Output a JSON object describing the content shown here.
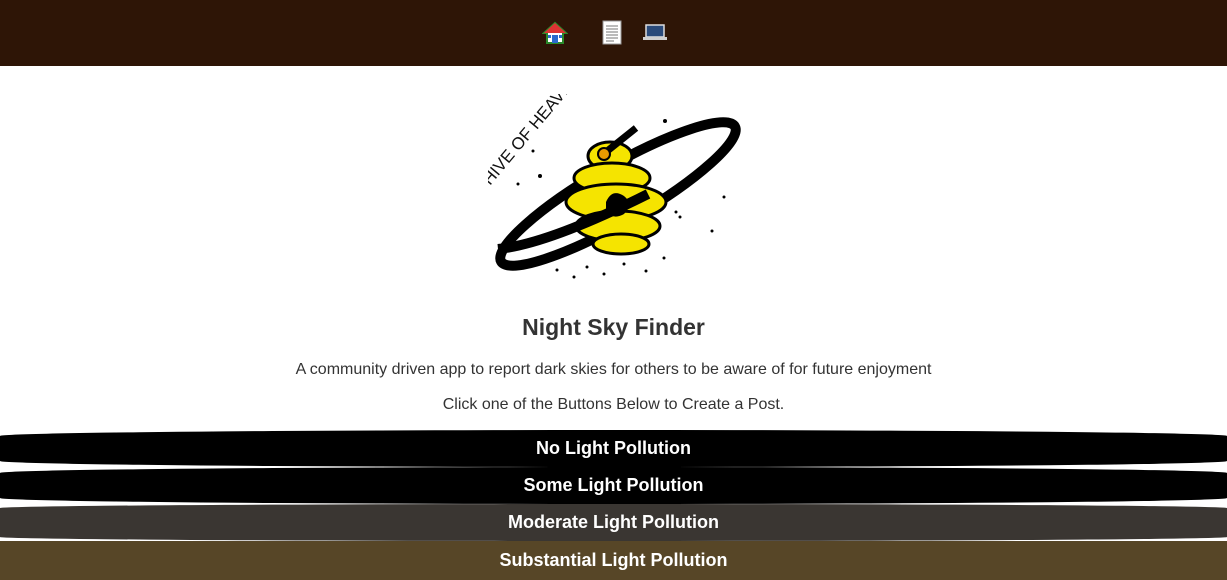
{
  "nav": {
    "items": [
      {
        "icon": "house-icon",
        "label": "Home"
      },
      {
        "icon": "document-icon",
        "label": "Posts"
      },
      {
        "icon": "laptop-icon",
        "label": "Computer"
      }
    ],
    "background": "#2e1506"
  },
  "logo": {
    "text": "HIVE OF HEAVEN"
  },
  "main": {
    "title": "Night Sky Finder",
    "tagline": "A community driven app to report dark skies for others to be aware of for future enjoyment",
    "instruction": "Click one of the Buttons Below to Create a Post."
  },
  "buttons": [
    {
      "label": "No Light Pollution",
      "color": "#000000"
    },
    {
      "label": "Some Light Pollution",
      "color": "#000000"
    },
    {
      "label": "Moderate Light Pollution",
      "color": "#3a3632"
    },
    {
      "label": "Substantial Light Pollution",
      "color": "#574627"
    }
  ]
}
